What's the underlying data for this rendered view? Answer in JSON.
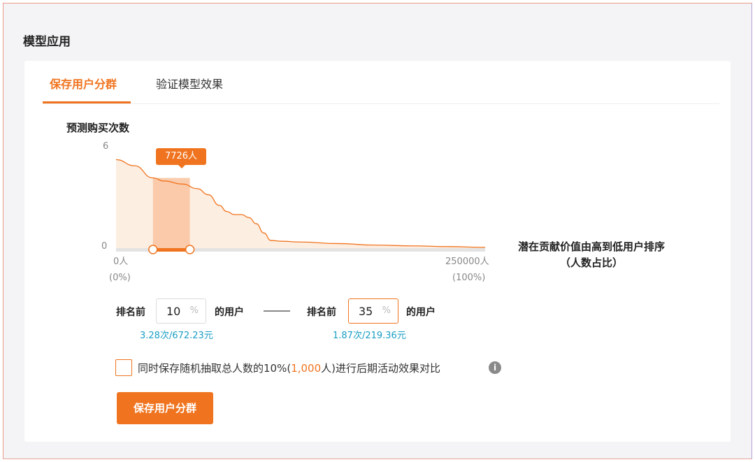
{
  "section_title": "模型应用",
  "tabs": [
    {
      "label": "保存用户分群",
      "active": true
    },
    {
      "label": "验证模型效果",
      "active": false
    }
  ],
  "chart": {
    "title": "预测购买次数",
    "y_max_label": "6",
    "y_min_label": "0",
    "x_start_label": "0人",
    "x_start_pct": "(0%)",
    "x_end_label": "250000人",
    "x_end_pct": "(100%)",
    "x_axis_title_line1": "潜在贡献价值由高到低用户排序",
    "x_axis_title_line2": "（人数占比）",
    "tooltip": "7726人",
    "accent_color": "#f0741f"
  },
  "chart_data": {
    "type": "area",
    "ylim": [
      0,
      6
    ],
    "xlim_pct": [
      0,
      100
    ],
    "x_pct": [
      0,
      5,
      10,
      13,
      18,
      22,
      25,
      28,
      30,
      32,
      34,
      36,
      38,
      40,
      42,
      45,
      50,
      60,
      70,
      80,
      90,
      100
    ],
    "y": [
      5.8,
      5.4,
      4.6,
      4.4,
      4.2,
      3.9,
      3.5,
      2.8,
      2.4,
      2.2,
      2.2,
      2.0,
      1.6,
      1.0,
      0.5,
      0.45,
      0.4,
      0.3,
      0.2,
      0.15,
      0.1,
      0.05
    ],
    "selected_range_pct": [
      10,
      20
    ],
    "tooltip_value": "7726人"
  },
  "range": {
    "from_prefix": "排名前",
    "from_value": "10",
    "from_unit": "%",
    "from_suffix": "的用户",
    "from_stat": "3.28次/672.23元",
    "to_prefix": "排名前",
    "to_value": "35",
    "to_unit": "%",
    "to_suffix": "的用户",
    "to_stat": "1.87次/219.36元"
  },
  "control_group": {
    "text_before": "同时保存随机抽取总人数的10%(",
    "highlight": "1,000",
    "text_after": "人)进行后期活动效果对比",
    "checked": false,
    "info_icon": "info-icon"
  },
  "save_button": "保存用户分群"
}
